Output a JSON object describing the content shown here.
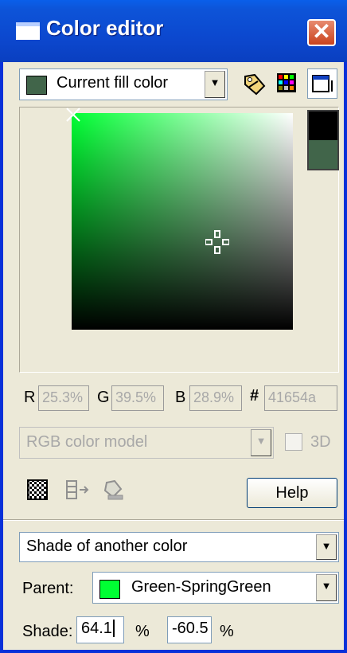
{
  "window": {
    "title": "Color editor",
    "close_glyph": "✕"
  },
  "top_bar": {
    "target_select": {
      "value": "Current fill color",
      "swatch_color": "#41654a"
    },
    "icons": [
      "tag-icon",
      "palette-grid-icon",
      "panel-toggle-icon"
    ]
  },
  "picker": {
    "hue_color": "#00ff33",
    "preview_top_color": "#000000",
    "preview_bottom_color": "#41654a"
  },
  "channels": {
    "r_label": "R",
    "r_value": "25.3%",
    "g_label": "G",
    "g_value": "39.5%",
    "b_label": "B",
    "b_value": "28.9%",
    "hex_label": "#",
    "hex_value": "41654a"
  },
  "model": {
    "select_value": "RGB color model",
    "check_3d_label": "3D"
  },
  "tools": {
    "help_label": "Help",
    "icons": [
      "checker-pattern-icon",
      "insert-row-icon",
      "stamp-icon"
    ]
  },
  "shade": {
    "type_select": "Shade of another color",
    "parent_label": "Parent:",
    "parent_value": "Green-SpringGreen",
    "parent_color": "#00ff33",
    "shade_label": "Shade:",
    "shade_value_1": "64.1",
    "unit_1": "%",
    "shade_value_2": "-60.5",
    "unit_2": "%"
  }
}
